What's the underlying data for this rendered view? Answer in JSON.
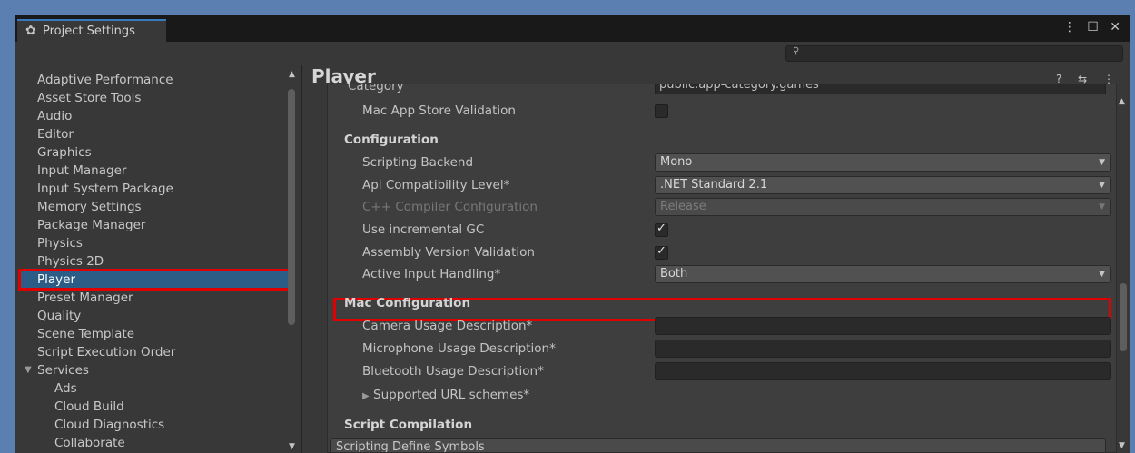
{
  "window": {
    "tab_title": "Project Settings",
    "controls_icons": [
      "more-icon",
      "maximize-icon",
      "close-icon"
    ]
  },
  "sidebar": {
    "items": [
      {
        "label": "Adaptive Performance"
      },
      {
        "label": "Asset Store Tools"
      },
      {
        "label": "Audio"
      },
      {
        "label": "Editor"
      },
      {
        "label": "Graphics"
      },
      {
        "label": "Input Manager"
      },
      {
        "label": "Input System Package"
      },
      {
        "label": "Memory Settings"
      },
      {
        "label": "Package Manager"
      },
      {
        "label": "Physics"
      },
      {
        "label": "Physics 2D"
      },
      {
        "label": "Player"
      },
      {
        "label": "Preset Manager"
      },
      {
        "label": "Quality"
      },
      {
        "label": "Scene Template"
      },
      {
        "label": "Script Execution Order"
      },
      {
        "label": "Services"
      },
      {
        "label": "Ads"
      },
      {
        "label": "Cloud Build"
      },
      {
        "label": "Cloud Diagnostics"
      },
      {
        "label": "Collaborate"
      }
    ],
    "selected": "Player"
  },
  "main": {
    "title": "Player",
    "cut_label": "Category",
    "cut_value": "public.app-category.games",
    "mac_app_store_validation": {
      "label": "Mac App Store Validation",
      "checked": false
    },
    "configuration": {
      "header": "Configuration",
      "scripting_backend": {
        "label": "Scripting Backend",
        "value": "Mono"
      },
      "api_compat": {
        "label": "Api Compatibility Level*",
        "value": ".NET Standard 2.1"
      },
      "cpp_compiler": {
        "label": "C++ Compiler Configuration",
        "value": "Release"
      },
      "incremental_gc": {
        "label": "Use incremental GC",
        "checked": true
      },
      "assembly_validation": {
        "label": "Assembly Version Validation",
        "checked": true
      },
      "active_input": {
        "label": "Active Input Handling*",
        "value": "Both"
      }
    },
    "mac_configuration": {
      "header": "Mac Configuration",
      "camera": {
        "label": "Camera Usage Description*",
        "value": ""
      },
      "microphone": {
        "label": "Microphone Usage Description*",
        "value": ""
      },
      "bluetooth": {
        "label": "Bluetooth Usage Description*",
        "value": ""
      },
      "url_schemes": {
        "label": "Supported URL schemes*"
      }
    },
    "script_compilation": {
      "header": "Script Compilation",
      "define_symbols": "Scripting Define Symbols"
    }
  },
  "glyphs": {
    "gear": "✿",
    "check": "✓",
    "caret": "▼",
    "up": "▲",
    "triangle_right": "▶",
    "triangle_down": "▼",
    "search": "🔍︎",
    "window_controls": "⋮ ☐ ✕",
    "header_icons": "? ⇆ ⋮"
  },
  "colors": {
    "selected_bg": "#2c5d87",
    "highlight": "#e10000",
    "accent": "#3a79bb"
  }
}
